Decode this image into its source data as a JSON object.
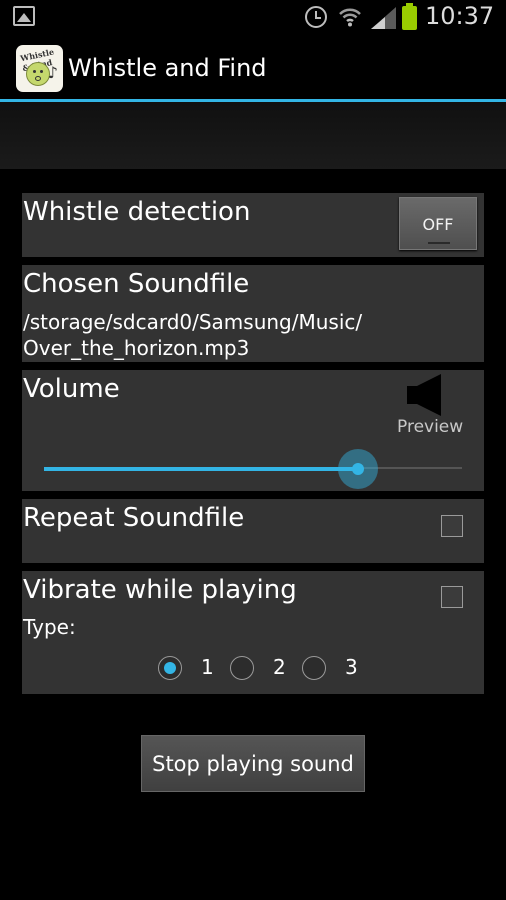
{
  "status_bar": {
    "time": "10:37",
    "icons": [
      "gallery-icon",
      "alarm-icon",
      "wifi-icon",
      "signal-icon",
      "battery-icon"
    ],
    "battery_color": "#99cc00"
  },
  "action_bar": {
    "title": "Whistle and Find",
    "icon_text": "Whistle & Find",
    "accent_color": "#33b5e5"
  },
  "whistle_detection": {
    "label": "Whistle detection",
    "toggle_label": "OFF"
  },
  "soundfile": {
    "label": "Chosen Soundfile",
    "path_line1": "/storage/sdcard0/Samsung/Music/",
    "path_line2": "Over_the_horizon.mp3"
  },
  "volume": {
    "label": "Volume",
    "preview_label": "Preview",
    "level": 0.75
  },
  "repeat": {
    "label": "Repeat Soundfile",
    "checked": false
  },
  "vibrate": {
    "label": "Vibrate while playing",
    "checked": false,
    "type_label": "Type:",
    "options": [
      "1",
      "2",
      "3"
    ],
    "selected": "1"
  },
  "stop_button": {
    "label": "Stop playing sound"
  }
}
